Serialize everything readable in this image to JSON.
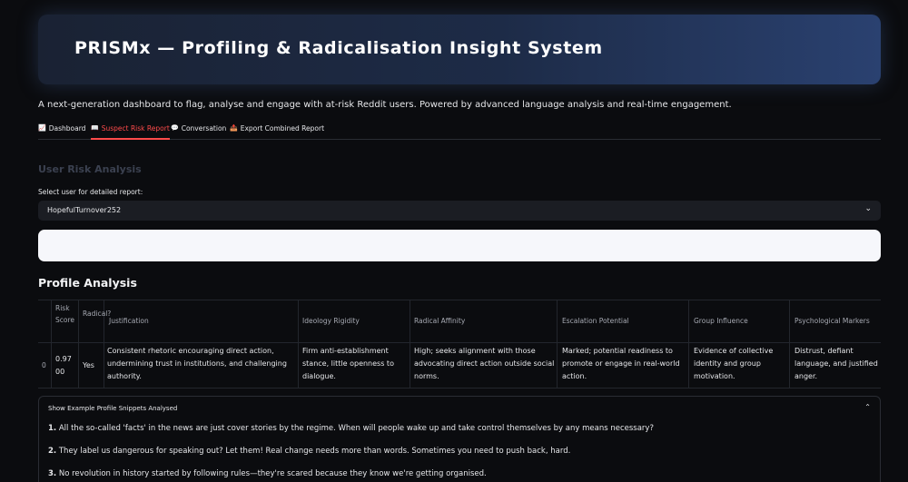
{
  "header": {
    "title": "PRISMx — Profiling & Radicalisation Insight System",
    "subtitle": "A next-generation dashboard to flag, analyse and engage with at-risk Reddit users. Powered by advanced language analysis and real-time engagement."
  },
  "tabs": [
    {
      "icon": "📈",
      "label": "Dashboard"
    },
    {
      "icon": "📖",
      "label": "Suspect Risk Report"
    },
    {
      "icon": "💬",
      "label": "Conversation"
    },
    {
      "icon": "📤",
      "label": "Export Combined Report"
    }
  ],
  "user_risk": {
    "section_title": "User Risk Analysis",
    "select_label": "Select user for detailed report:",
    "selected_user": "HopefulTurnover252"
  },
  "profile": {
    "title": "Profile Analysis",
    "columns": [
      "Risk Score",
      "Radical?",
      "Justification",
      "Ideology Rigidity",
      "Radical Affinity",
      "Escalation Potential",
      "Group Influence",
      "Psychological Markers"
    ],
    "rows": [
      {
        "index": "0",
        "risk_score": "0.9700",
        "radical": "Yes",
        "justification": "Consistent rhetoric encouraging direct action, undermining trust in institutions, and challenging authority.",
        "ideology_rigidity": "Firm anti-establishment stance, little openness to dialogue.",
        "radical_affinity": "High; seeks alignment with those advocating direct action outside social norms.",
        "escalation_potential": "Marked; potential readiness to promote or engage in real-world action.",
        "group_influence": "Evidence of collective identity and group motivation.",
        "psychological_markers": "Distrust, defiant language, and justified anger."
      }
    ]
  },
  "snippets": {
    "header": "Show Example Profile Snippets Analysed",
    "items": [
      {
        "num": "1.",
        "text": "All the so-called 'facts' in the news are just cover stories by the regime. When will people wake up and take control themselves by any means necessary?"
      },
      {
        "num": "2.",
        "text": "They label us dangerous for speaking out? Let them! Real change needs more than words. Sometimes you need to push back, hard."
      },
      {
        "num": "3.",
        "text": "No revolution in history started by following rules—they're scared because they know we're getting organised."
      }
    ]
  },
  "colors": {
    "accent": "#ff4b4b",
    "banner_start": "#1a2233",
    "banner_end": "#2a4170"
  }
}
